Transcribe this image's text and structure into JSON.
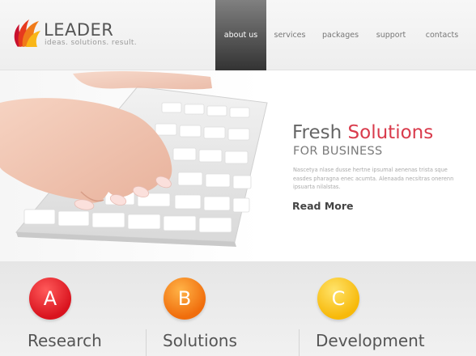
{
  "brand": {
    "name": "LEADER",
    "tagline": "ideas. solutions. result."
  },
  "nav": {
    "items": [
      {
        "label": "about us",
        "active": true
      },
      {
        "label": "services",
        "active": false
      },
      {
        "label": "packages",
        "active": false
      },
      {
        "label": "support",
        "active": false
      },
      {
        "label": "contacts",
        "active": false
      }
    ]
  },
  "hero": {
    "title_part1": "Fresh",
    "title_part2": "Solutions",
    "subtitle": "FOR BUSINESS",
    "body": "Nascetya nlase dusse hertne ipsumal aenenas trista sque easdes pharagna enec acumta. Alenaada necsitras onerenn ipsuarta nilalstas.",
    "read_more": "Read More"
  },
  "features": [
    {
      "letter": "A",
      "title": "Research",
      "color": "#e0202a"
    },
    {
      "letter": "B",
      "title": "Solutions",
      "color": "#f47a14"
    },
    {
      "letter": "C",
      "title": "Development",
      "color": "#f9c210"
    }
  ],
  "colors": {
    "accent_red": "#d93b4c",
    "nav_active": "#4a4a4a"
  },
  "icons": {
    "logo": "flame-petals-logo-icon"
  }
}
